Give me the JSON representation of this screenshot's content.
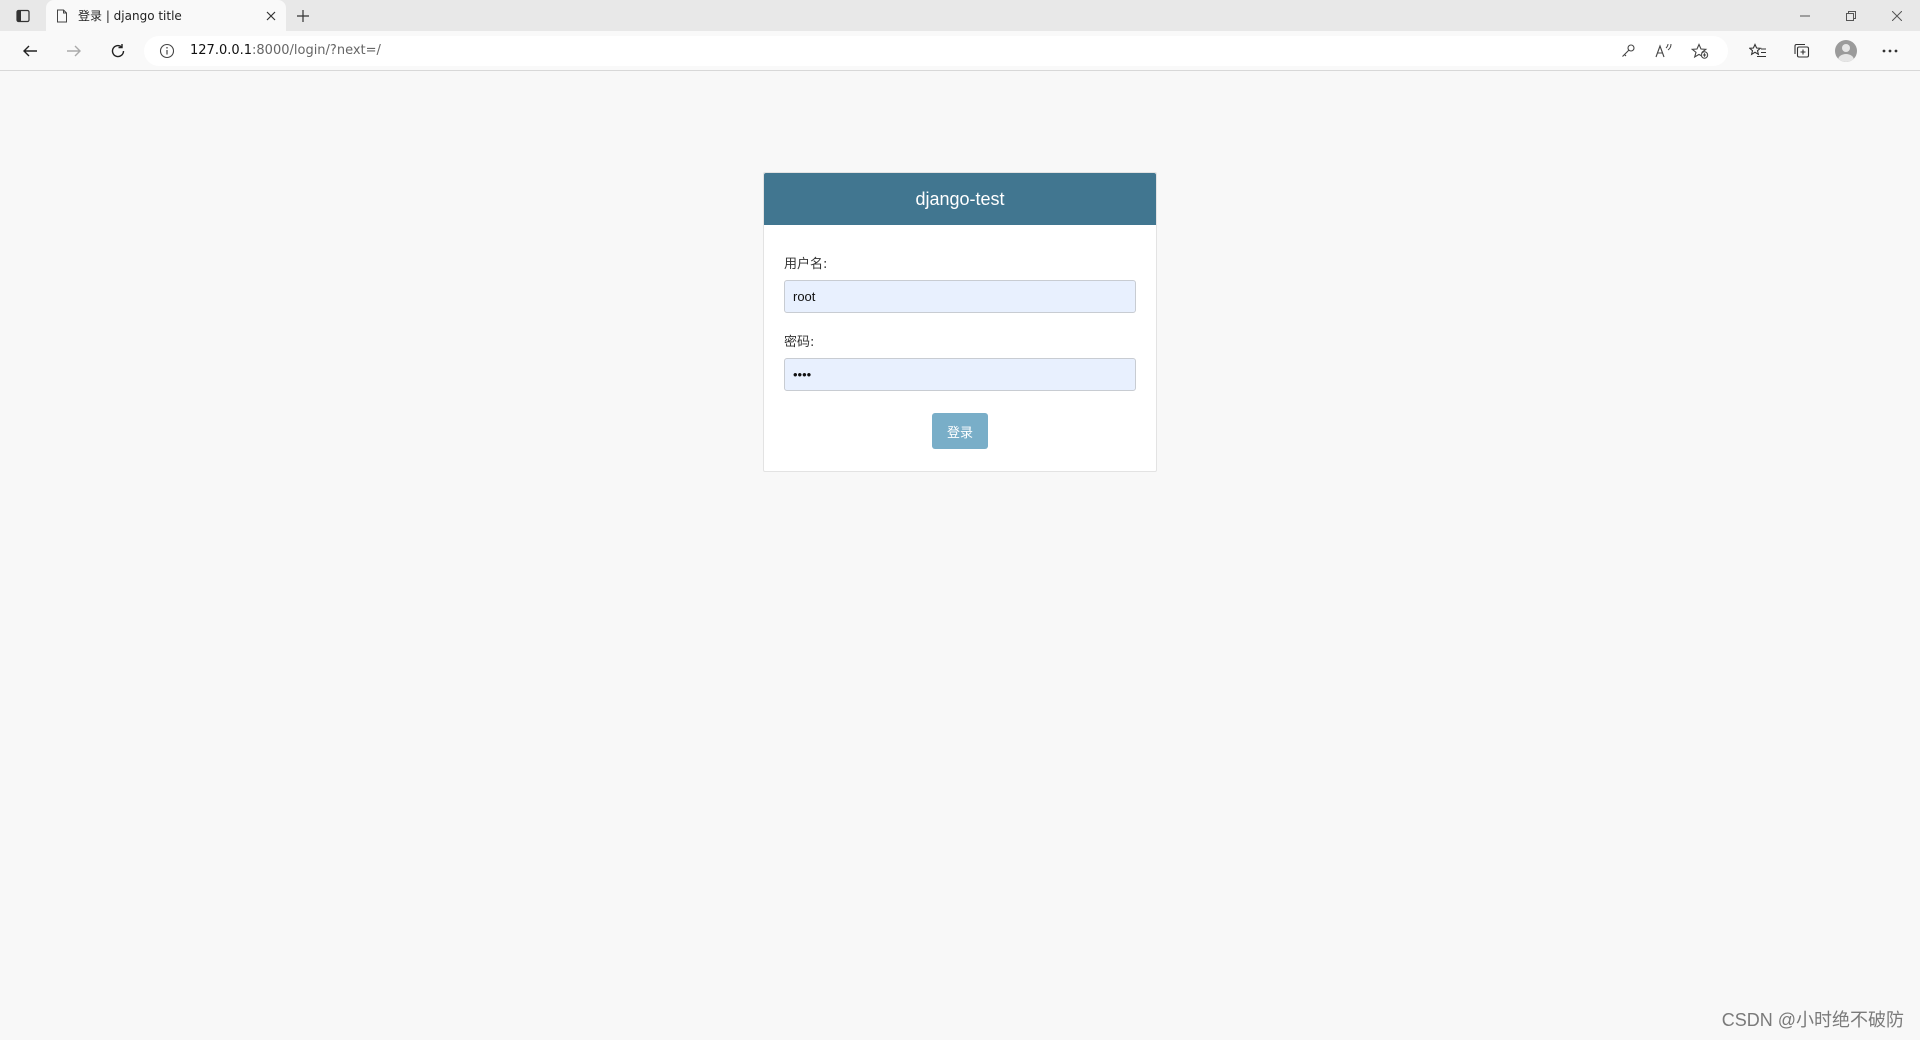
{
  "browser": {
    "tab": {
      "title": "登录 | django title"
    },
    "address": {
      "host": "127.0.0.1",
      "path": ":8000/login/?next=/"
    }
  },
  "login": {
    "header_title": "django-test",
    "username_label": "用户名:",
    "username_value": "root",
    "password_label": "密码:",
    "password_value": "root",
    "submit_label": "登录"
  },
  "watermark": "CSDN @小时绝不破防",
  "colors": {
    "header_bg": "#417690",
    "button_bg": "#79aec8",
    "input_bg": "#e8f0fe",
    "page_bg": "#f8f8f8"
  }
}
